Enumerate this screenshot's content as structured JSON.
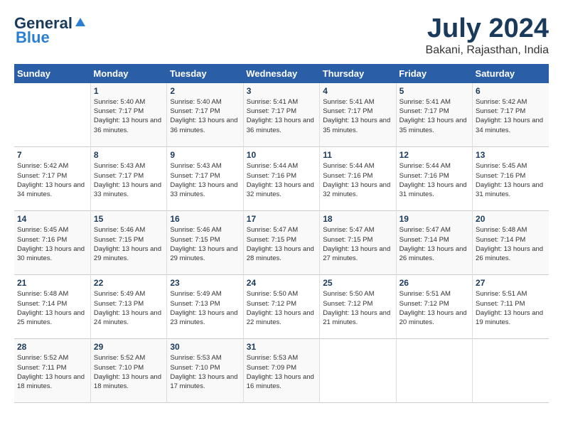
{
  "logo": {
    "general": "General",
    "blue": "Blue"
  },
  "title": "July 2024",
  "location": "Bakani, Rajasthan, India",
  "headers": [
    "Sunday",
    "Monday",
    "Tuesday",
    "Wednesday",
    "Thursday",
    "Friday",
    "Saturday"
  ],
  "weeks": [
    [
      {
        "day": "",
        "sunrise": "",
        "sunset": "",
        "daylight": ""
      },
      {
        "day": "1",
        "sunrise": "Sunrise: 5:40 AM",
        "sunset": "Sunset: 7:17 PM",
        "daylight": "Daylight: 13 hours and 36 minutes."
      },
      {
        "day": "2",
        "sunrise": "Sunrise: 5:40 AM",
        "sunset": "Sunset: 7:17 PM",
        "daylight": "Daylight: 13 hours and 36 minutes."
      },
      {
        "day": "3",
        "sunrise": "Sunrise: 5:41 AM",
        "sunset": "Sunset: 7:17 PM",
        "daylight": "Daylight: 13 hours and 36 minutes."
      },
      {
        "day": "4",
        "sunrise": "Sunrise: 5:41 AM",
        "sunset": "Sunset: 7:17 PM",
        "daylight": "Daylight: 13 hours and 35 minutes."
      },
      {
        "day": "5",
        "sunrise": "Sunrise: 5:41 AM",
        "sunset": "Sunset: 7:17 PM",
        "daylight": "Daylight: 13 hours and 35 minutes."
      },
      {
        "day": "6",
        "sunrise": "Sunrise: 5:42 AM",
        "sunset": "Sunset: 7:17 PM",
        "daylight": "Daylight: 13 hours and 34 minutes."
      }
    ],
    [
      {
        "day": "7",
        "sunrise": "Sunrise: 5:42 AM",
        "sunset": "Sunset: 7:17 PM",
        "daylight": "Daylight: 13 hours and 34 minutes."
      },
      {
        "day": "8",
        "sunrise": "Sunrise: 5:43 AM",
        "sunset": "Sunset: 7:17 PM",
        "daylight": "Daylight: 13 hours and 33 minutes."
      },
      {
        "day": "9",
        "sunrise": "Sunrise: 5:43 AM",
        "sunset": "Sunset: 7:17 PM",
        "daylight": "Daylight: 13 hours and 33 minutes."
      },
      {
        "day": "10",
        "sunrise": "Sunrise: 5:44 AM",
        "sunset": "Sunset: 7:16 PM",
        "daylight": "Daylight: 13 hours and 32 minutes."
      },
      {
        "day": "11",
        "sunrise": "Sunrise: 5:44 AM",
        "sunset": "Sunset: 7:16 PM",
        "daylight": "Daylight: 13 hours and 32 minutes."
      },
      {
        "day": "12",
        "sunrise": "Sunrise: 5:44 AM",
        "sunset": "Sunset: 7:16 PM",
        "daylight": "Daylight: 13 hours and 31 minutes."
      },
      {
        "day": "13",
        "sunrise": "Sunrise: 5:45 AM",
        "sunset": "Sunset: 7:16 PM",
        "daylight": "Daylight: 13 hours and 31 minutes."
      }
    ],
    [
      {
        "day": "14",
        "sunrise": "Sunrise: 5:45 AM",
        "sunset": "Sunset: 7:16 PM",
        "daylight": "Daylight: 13 hours and 30 minutes."
      },
      {
        "day": "15",
        "sunrise": "Sunrise: 5:46 AM",
        "sunset": "Sunset: 7:15 PM",
        "daylight": "Daylight: 13 hours and 29 minutes."
      },
      {
        "day": "16",
        "sunrise": "Sunrise: 5:46 AM",
        "sunset": "Sunset: 7:15 PM",
        "daylight": "Daylight: 13 hours and 29 minutes."
      },
      {
        "day": "17",
        "sunrise": "Sunrise: 5:47 AM",
        "sunset": "Sunset: 7:15 PM",
        "daylight": "Daylight: 13 hours and 28 minutes."
      },
      {
        "day": "18",
        "sunrise": "Sunrise: 5:47 AM",
        "sunset": "Sunset: 7:15 PM",
        "daylight": "Daylight: 13 hours and 27 minutes."
      },
      {
        "day": "19",
        "sunrise": "Sunrise: 5:47 AM",
        "sunset": "Sunset: 7:14 PM",
        "daylight": "Daylight: 13 hours and 26 minutes."
      },
      {
        "day": "20",
        "sunrise": "Sunrise: 5:48 AM",
        "sunset": "Sunset: 7:14 PM",
        "daylight": "Daylight: 13 hours and 26 minutes."
      }
    ],
    [
      {
        "day": "21",
        "sunrise": "Sunrise: 5:48 AM",
        "sunset": "Sunset: 7:14 PM",
        "daylight": "Daylight: 13 hours and 25 minutes."
      },
      {
        "day": "22",
        "sunrise": "Sunrise: 5:49 AM",
        "sunset": "Sunset: 7:13 PM",
        "daylight": "Daylight: 13 hours and 24 minutes."
      },
      {
        "day": "23",
        "sunrise": "Sunrise: 5:49 AM",
        "sunset": "Sunset: 7:13 PM",
        "daylight": "Daylight: 13 hours and 23 minutes."
      },
      {
        "day": "24",
        "sunrise": "Sunrise: 5:50 AM",
        "sunset": "Sunset: 7:12 PM",
        "daylight": "Daylight: 13 hours and 22 minutes."
      },
      {
        "day": "25",
        "sunrise": "Sunrise: 5:50 AM",
        "sunset": "Sunset: 7:12 PM",
        "daylight": "Daylight: 13 hours and 21 minutes."
      },
      {
        "day": "26",
        "sunrise": "Sunrise: 5:51 AM",
        "sunset": "Sunset: 7:12 PM",
        "daylight": "Daylight: 13 hours and 20 minutes."
      },
      {
        "day": "27",
        "sunrise": "Sunrise: 5:51 AM",
        "sunset": "Sunset: 7:11 PM",
        "daylight": "Daylight: 13 hours and 19 minutes."
      }
    ],
    [
      {
        "day": "28",
        "sunrise": "Sunrise: 5:52 AM",
        "sunset": "Sunset: 7:11 PM",
        "daylight": "Daylight: 13 hours and 18 minutes."
      },
      {
        "day": "29",
        "sunrise": "Sunrise: 5:52 AM",
        "sunset": "Sunset: 7:10 PM",
        "daylight": "Daylight: 13 hours and 18 minutes."
      },
      {
        "day": "30",
        "sunrise": "Sunrise: 5:53 AM",
        "sunset": "Sunset: 7:10 PM",
        "daylight": "Daylight: 13 hours and 17 minutes."
      },
      {
        "day": "31",
        "sunrise": "Sunrise: 5:53 AM",
        "sunset": "Sunset: 7:09 PM",
        "daylight": "Daylight: 13 hours and 16 minutes."
      },
      {
        "day": "",
        "sunrise": "",
        "sunset": "",
        "daylight": ""
      },
      {
        "day": "",
        "sunrise": "",
        "sunset": "",
        "daylight": ""
      },
      {
        "day": "",
        "sunrise": "",
        "sunset": "",
        "daylight": ""
      }
    ]
  ]
}
